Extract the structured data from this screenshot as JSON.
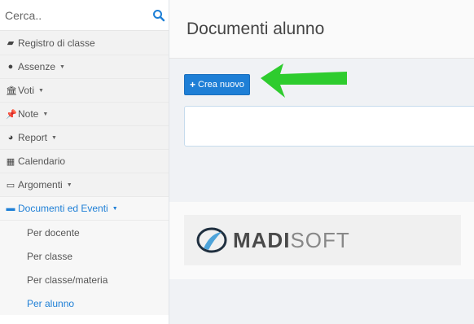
{
  "sidebar": {
    "search": {
      "placeholder": "Cerca.."
    },
    "items": [
      {
        "label": "Registro di classe",
        "icon": "book-icon",
        "caret": false
      },
      {
        "label": "Assenze",
        "icon": "user-icon",
        "caret": true
      },
      {
        "label": "Voti",
        "icon": "bank-icon",
        "caret": true
      },
      {
        "label": "Note",
        "icon": "pushpin-icon",
        "caret": true
      },
      {
        "label": "Report",
        "icon": "pie-chart-icon",
        "caret": true
      },
      {
        "label": "Calendario",
        "icon": "calendar-icon",
        "caret": false
      },
      {
        "label": "Argomenti",
        "icon": "folder-open-icon",
        "caret": true
      },
      {
        "label": "Documenti ed Eventi",
        "icon": "inbox-icon",
        "caret": true,
        "active": true
      }
    ],
    "subitems": [
      {
        "label": "Per docente"
      },
      {
        "label": "Per classe"
      },
      {
        "label": "Per classe/materia"
      },
      {
        "label": "Per alunno",
        "active": true
      }
    ]
  },
  "main": {
    "title": "Documenti alunno",
    "new_button_label": "Crea nuovo",
    "logo": {
      "bold": "MADI",
      "thin": "SOFT"
    }
  },
  "colors": {
    "accent": "#1e7fd6",
    "arrow": "#2ecc2e"
  }
}
